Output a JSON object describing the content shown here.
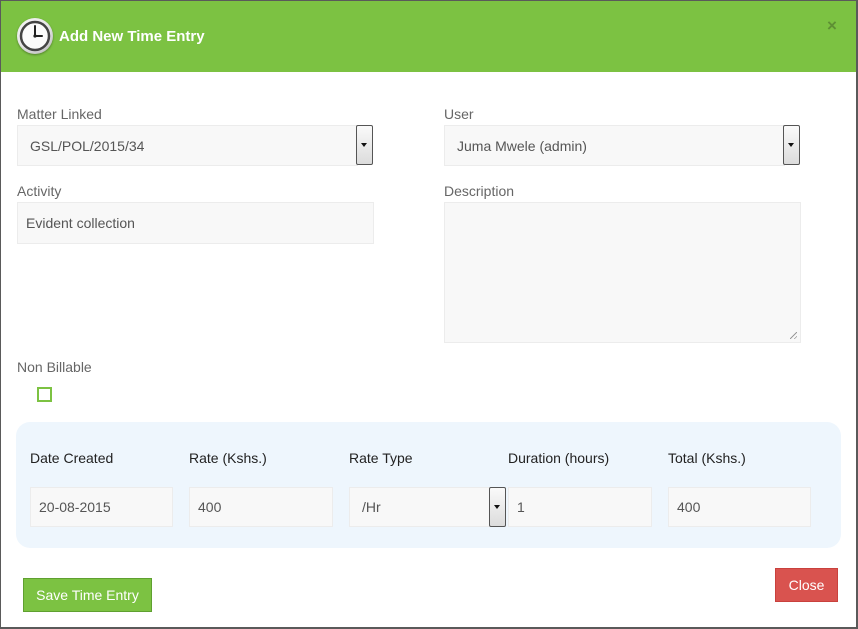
{
  "header": {
    "title": "Add New Time Entry",
    "icon": "clock-icon",
    "close_symbol": "×"
  },
  "form": {
    "matter_label": "Matter Linked",
    "matter_value": "GSL/POL/2015/34",
    "user_label": "User",
    "user_value": "Juma Mwele (admin)",
    "activity_label": "Activity",
    "activity_value": "Evident collection",
    "description_label": "Description",
    "description_value": "",
    "non_billable_label": "Non Billable",
    "non_billable_checked": false
  },
  "rate_panel": {
    "date_label": "Date Created",
    "date_value": "20-08-2015",
    "rate_label": "Rate (Kshs.)",
    "rate_value": "400",
    "rate_type_label": "Rate Type",
    "rate_type_value": "/Hr",
    "duration_label": "Duration (hours)",
    "duration_value": "1",
    "total_label": "Total (Kshs.)",
    "total_value": "400"
  },
  "buttons": {
    "save_label": "Save Time Entry",
    "close_label": "Close"
  },
  "colors": {
    "header_green": "#7cc242",
    "close_red": "#d9534f",
    "panel_blue": "#eef6fd"
  }
}
